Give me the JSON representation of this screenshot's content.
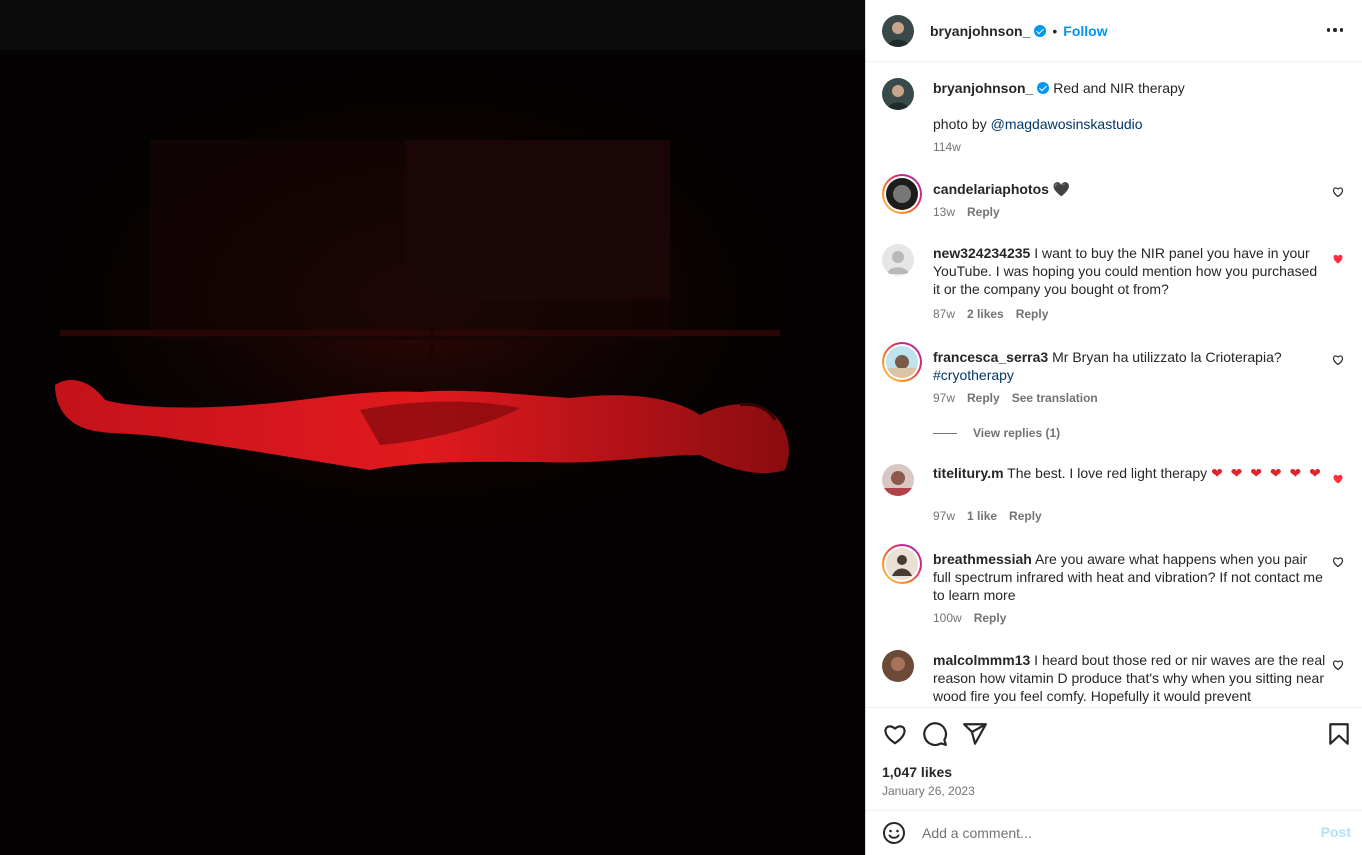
{
  "post": {
    "username": "bryanjohnson_",
    "follow_label": "Follow",
    "separator": "•",
    "caption_text": "Red and NIR therapy",
    "caption_line2_prefix": "photo by ",
    "caption_mention": "@magdawosinskastudio",
    "caption_time": "114w"
  },
  "comments": [
    {
      "user": "candelariaphotos",
      "text": "🖤",
      "time": "13w",
      "likes": "",
      "reply": "Reply",
      "liked": false
    },
    {
      "user": "new324234235",
      "text": "I want to buy the NIR panel you have in your YouTube. I was hoping you could mention how you purchased it or the company you bought ot from?",
      "time": "87w",
      "likes": "2 likes",
      "reply": "Reply",
      "liked": true
    },
    {
      "user": "francesca_serra3",
      "text": "Mr Bryan ha utilizzato la Crioterapia?",
      "hashtag": "#cryotherapy",
      "time": "97w",
      "likes": "",
      "reply": "Reply",
      "translate": "See translation",
      "view_replies": "View replies (1)",
      "liked": false
    },
    {
      "user": "titelitury.m",
      "text": "The best. I love red light therapy",
      "time": "97w",
      "likes": "1 like",
      "reply": "Reply",
      "liked": true
    },
    {
      "user": "breathmessiah",
      "text": "Are you aware what happens when you pair full spectrum infrared with heat and vibration? If not contact me to learn more",
      "time": "100w",
      "likes": "",
      "reply": "Reply",
      "liked": false
    },
    {
      "user": "malcolmmm13",
      "text": "I heard bout those red or nir waves are the real reason how vitamin D produce that's why when you sitting near wood fire you feel comfy. Hopefully it would prevent",
      "time": "",
      "likes": "",
      "reply": "",
      "liked": false
    }
  ],
  "actions": {
    "likes": "1,047 likes",
    "date": "January 26, 2023"
  },
  "composer": {
    "placeholder": "Add a comment...",
    "post_label": "Post"
  },
  "icons": {
    "more": "more-options-icon",
    "like": "heart-icon",
    "comment": "comment-icon",
    "share": "share-icon",
    "save": "bookmark-icon",
    "emoji": "emoji-icon"
  },
  "colors": {
    "accent": "#0095f6",
    "like_red": "#ff3040",
    "photo_red": "#e0141a"
  }
}
